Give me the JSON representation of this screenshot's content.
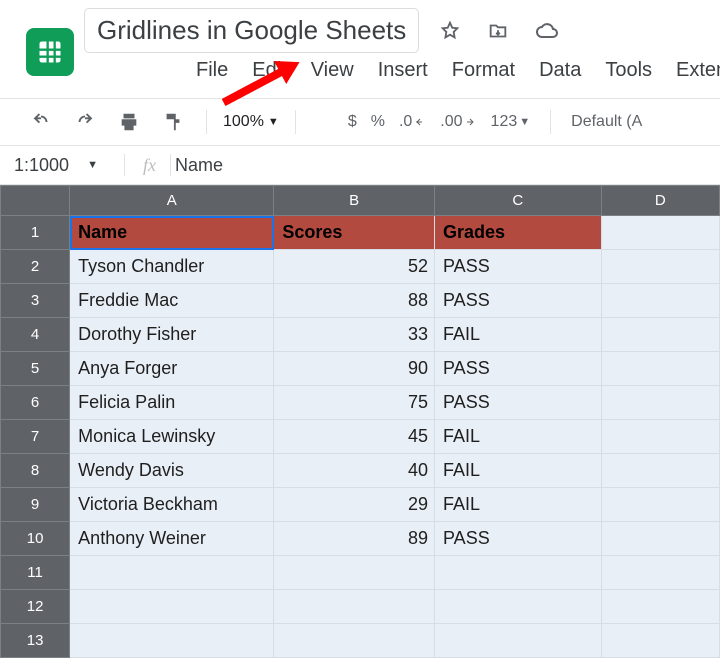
{
  "doc": {
    "title": "Gridlines in Google Sheets"
  },
  "menu": {
    "file": "File",
    "edit": "Edit",
    "view": "View",
    "insert": "Insert",
    "format": "Format",
    "data": "Data",
    "tools": "Tools",
    "extensions": "Extensio"
  },
  "toolbar": {
    "zoom": "100%",
    "currency": "$",
    "percent": "%",
    "dec_dec": ".0",
    "inc_dec": ".00",
    "num_fmt": "123",
    "font_label": "Default (A"
  },
  "fx": {
    "name_box": "1:1000",
    "value": "Name"
  },
  "columns": {
    "A": "A",
    "B": "B",
    "C": "C",
    "D": "D"
  },
  "row_nums": [
    "1",
    "2",
    "3",
    "4",
    "5",
    "6",
    "7",
    "8",
    "9",
    "10",
    "11",
    "12",
    "13"
  ],
  "headers": {
    "name": "Name",
    "scores": "Scores",
    "grades": "Grades"
  },
  "rows": [
    {
      "name": "Tyson Chandler",
      "score": "52",
      "grade": "PASS"
    },
    {
      "name": "Freddie Mac",
      "score": "88",
      "grade": "PASS"
    },
    {
      "name": "Dorothy Fisher",
      "score": "33",
      "grade": " FAIL"
    },
    {
      "name": "Anya Forger",
      "score": "90",
      "grade": "PASS"
    },
    {
      "name": "Felicia Palin",
      "score": "75",
      "grade": "PASS"
    },
    {
      "name": "Monica Lewinsky",
      "score": "45",
      "grade": "FAIL"
    },
    {
      "name": "Wendy Davis",
      "score": "40",
      "grade": "FAIL"
    },
    {
      "name": "Victoria Beckham",
      "score": "29",
      "grade": "FAIL"
    },
    {
      "name": "Anthony Weiner",
      "score": "89",
      "grade": "PASS"
    }
  ]
}
